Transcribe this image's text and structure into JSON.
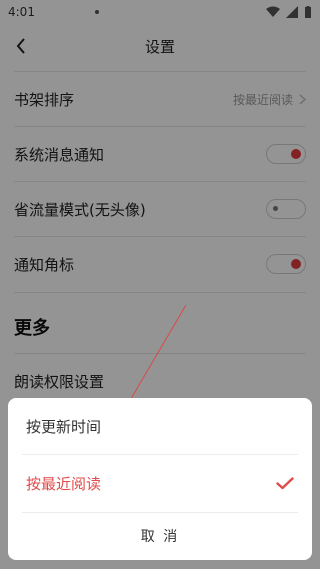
{
  "status_bar": {
    "time": "4:01"
  },
  "header": {
    "title": "设置"
  },
  "settings": {
    "shelf_sort_label": "书架排序",
    "shelf_sort_value": "按最近阅读",
    "system_notify_label": "系统消息通知",
    "data_saver_label": "省流量模式(无头像)",
    "badge_label": "通知角标",
    "more_title": "更多",
    "read_permission_label": "朗读权限设置"
  },
  "toggles": {
    "system_notify": "on",
    "data_saver": "off",
    "badge": "on"
  },
  "sort_sheet": {
    "options": [
      "按更新时间",
      "按最近阅读"
    ],
    "selected_index": 1,
    "cancel_label": "取 消"
  },
  "colors": {
    "accent": "#e14b4b",
    "toggle_on": "#e23b3b",
    "overlay": "rgba(0,0,0,0.42)"
  }
}
